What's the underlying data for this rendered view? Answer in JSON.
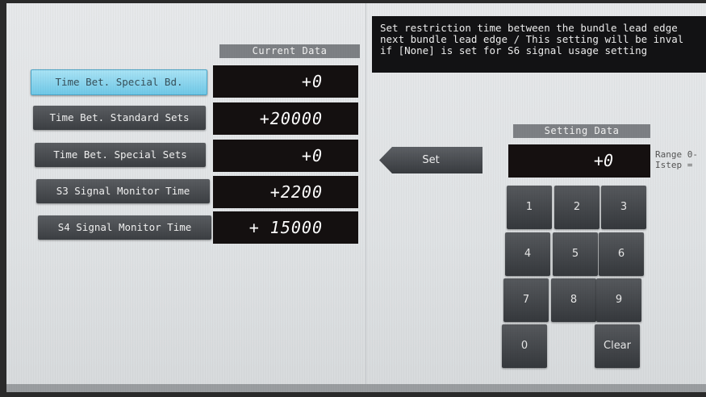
{
  "current_data_header": "Current Data",
  "setting_data_header": "Setting Data",
  "items": [
    {
      "label": "Time Bet. Special Bd.",
      "value": "+0"
    },
    {
      "label": "Time Bet. Standard Sets",
      "value": "+20000"
    },
    {
      "label": "Time Bet. Special Sets",
      "value": "+0"
    },
    {
      "label": "S3 Signal Monitor Time",
      "value": "+2200"
    },
    {
      "label": "S4 Signal Monitor Time",
      "value": "+ 15000"
    }
  ],
  "message": "Set restriction time between the bundle lead edge\nnext bundle lead edge / This setting will be inval\nif [None] is set for S6 signal usage setting",
  "set_label": "Set",
  "setting_value": "+0",
  "range_text": "Range 0-\nIstep =",
  "keypad": {
    "k1": "1",
    "k2": "2",
    "k3": "3",
    "k4": "4",
    "k5": "5",
    "k6": "6",
    "k7": "7",
    "k8": "8",
    "k9": "9",
    "k0": "0",
    "clear": "Clear"
  },
  "colors": {
    "active_item": "#7fd0ec",
    "button": "#45484c",
    "display": "#141010"
  }
}
